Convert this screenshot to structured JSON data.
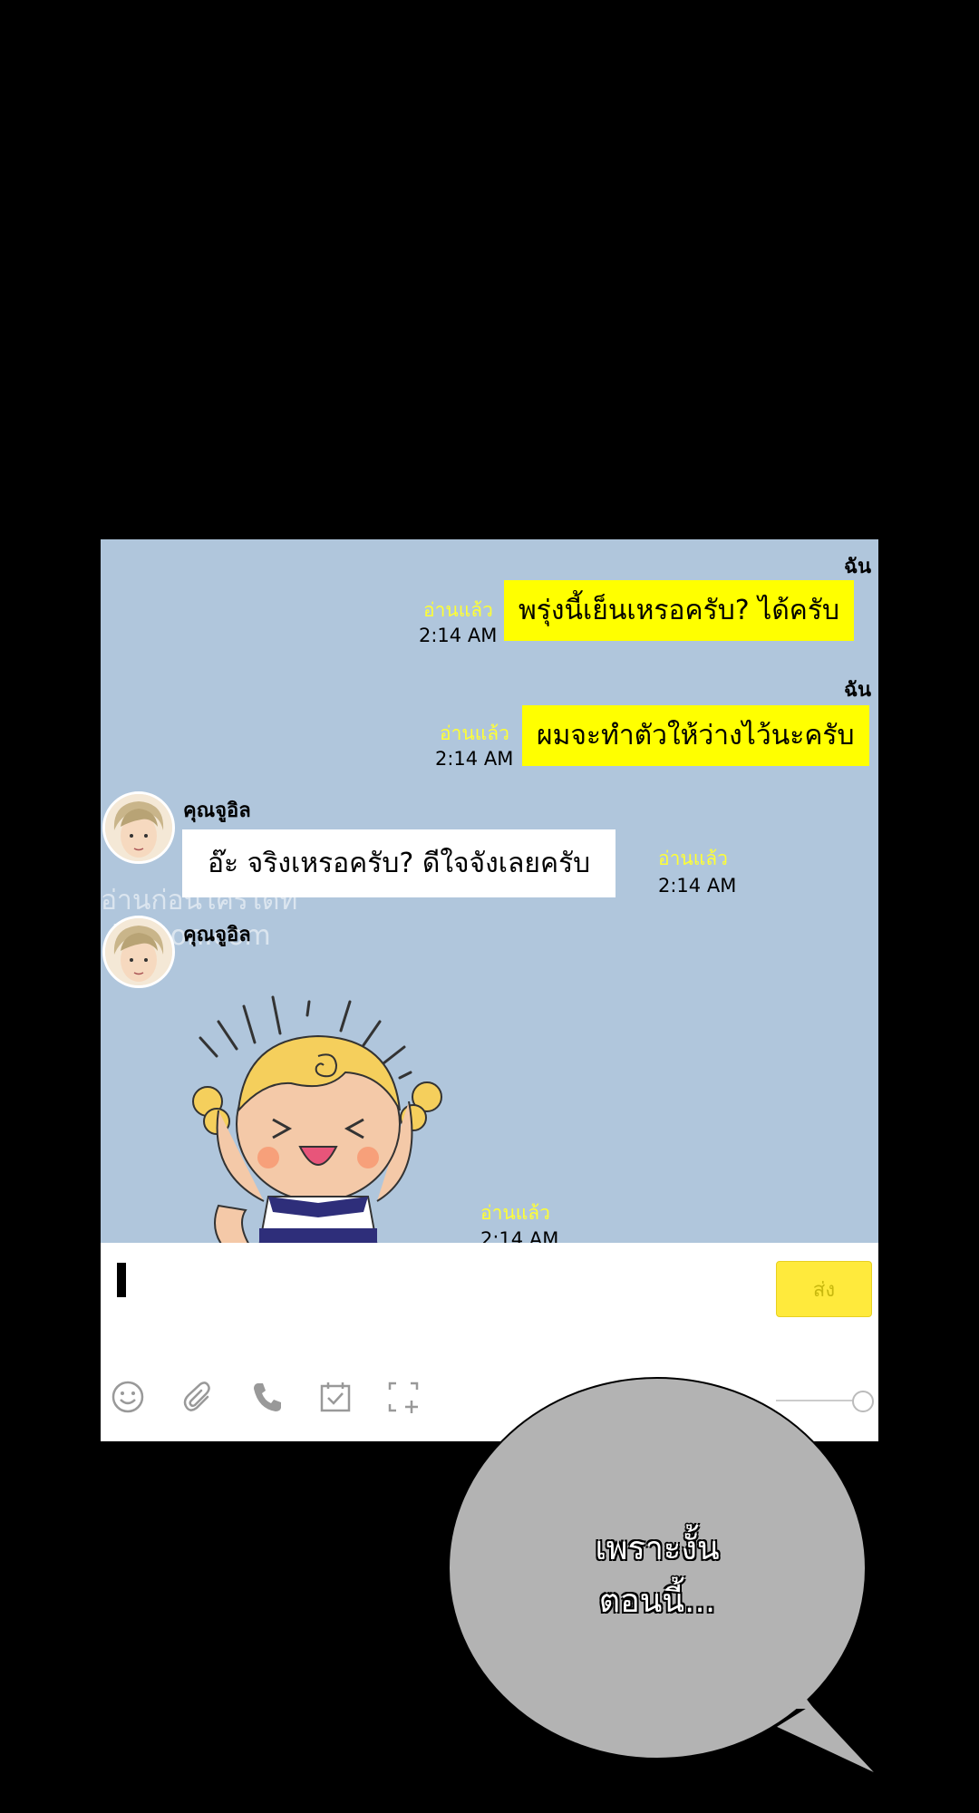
{
  "chat": {
    "messages": [
      {
        "sender": "ฉัน",
        "read": "อ่านแล้ว",
        "time": "2:14 AM",
        "text": "พรุ่งนี้เย็นเหรอครับ? ได้ครับ"
      },
      {
        "sender": "ฉัน",
        "read": "อ่านแล้ว",
        "time": "2:14 AM",
        "text": "ผมจะทำตัวให้ว่างไว้นะครับ"
      },
      {
        "sender": "คุณจูอิล",
        "read": "อ่านแล้ว",
        "time": "2:14 AM",
        "text": "อ๊ะ จริงเหรอครับ? ดีใจจังเลยครับ"
      },
      {
        "sender": "คุณจูอิล",
        "read": "อ่านแล้ว",
        "time": "2:14 AM"
      }
    ],
    "watermark_line1": "อ่านก่อนใครได้ที่",
    "watermark_line2": "kotoon.com"
  },
  "input": {
    "send_label": "ส่ง",
    "tools": [
      "emoji-icon",
      "attachment-icon",
      "phone-icon",
      "calendar-icon",
      "screenshot-icon"
    ]
  },
  "speech_bubble": {
    "line1": "เพราะงั้น",
    "line2": "ตอนนี้..."
  },
  "colors": {
    "chat_background": "#b0c6dc",
    "my_bubble": "#ffff00",
    "read_receipt": "#ffff33",
    "send_button": "#ffea3c",
    "speech_bubble": "#b3b3b3"
  }
}
